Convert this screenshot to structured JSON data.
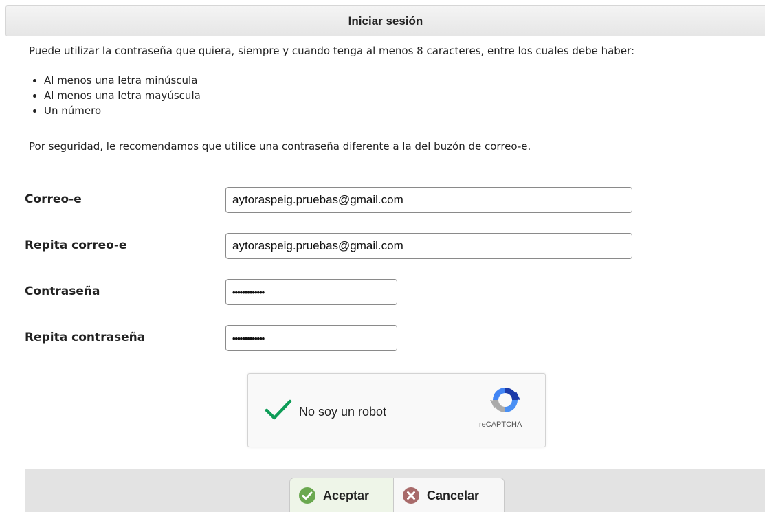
{
  "header": {
    "title": "Iniciar sesión"
  },
  "intro": {
    "text": "Puede utilizar la contraseña que quiera, siempre y cuando tenga al menos 8 caracteres, entre los cuales debe haber:",
    "rules": [
      "Al menos una letra minúscula",
      "Al menos una letra mayúscula",
      "Un número"
    ],
    "security_note": "Por seguridad, le recomendamos que utilice una contraseña diferente a la del buzón de correo-e."
  },
  "form": {
    "email_label": "Correo-e",
    "email_value": "aytoraspeig.pruebas@gmail.com",
    "email_repeat_label": "Repita correo-e",
    "email_repeat_value": "aytoraspeig.pruebas@gmail.com",
    "password_label": "Contraseña",
    "password_value": "•••••••••••••",
    "password_repeat_label": "Repita contraseña",
    "password_repeat_value": "•••••••••••••"
  },
  "captcha": {
    "label": "No soy un robot",
    "brand": "reCAPTCHA",
    "checked": true,
    "check_color": "#0f9d58"
  },
  "actions": {
    "accept_label": "Aceptar",
    "cancel_label": "Cancelar",
    "accept_icon": "check-circle-icon",
    "cancel_icon": "x-circle-icon",
    "accept_color": "#6aa84f",
    "cancel_color": "#a86a6a"
  }
}
